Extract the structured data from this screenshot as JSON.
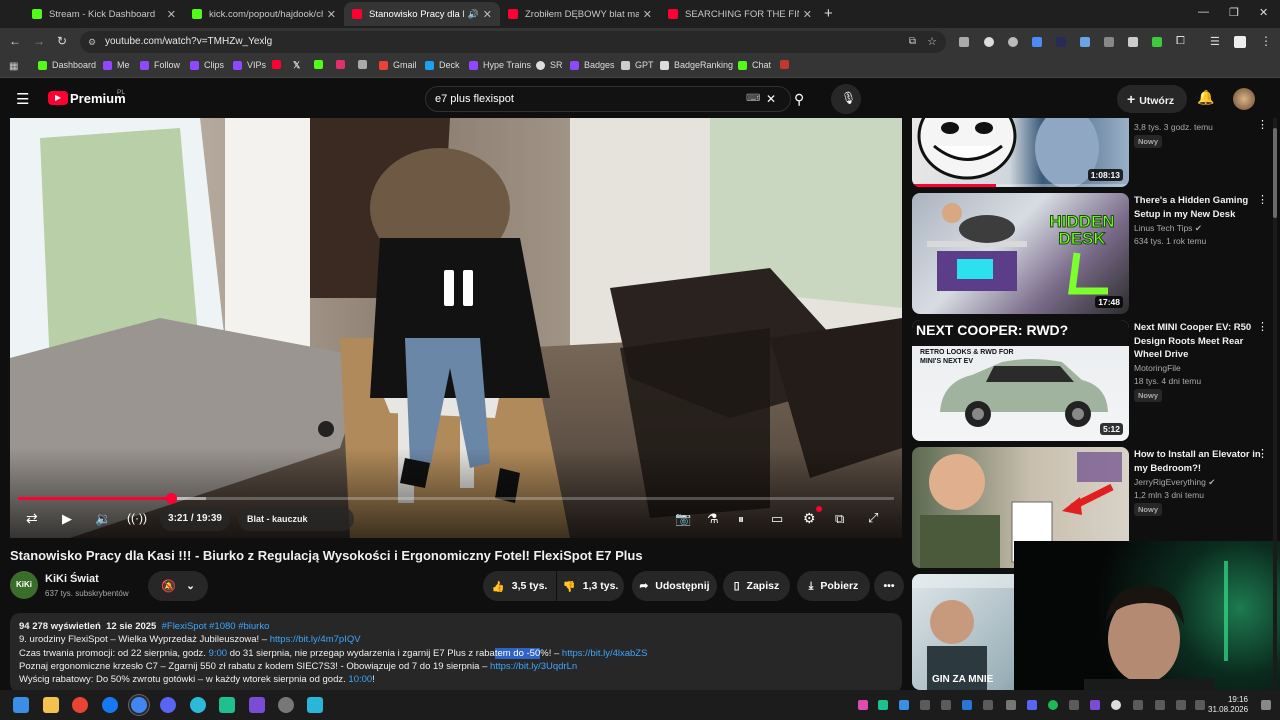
{
  "browser": {
    "tabs": [
      {
        "title": "Stream - Kick Dashboard",
        "color": "#53fc18"
      },
      {
        "title": "kick.com/popout/hajdook/chat",
        "color": "#53fc18"
      },
      {
        "title": "Stanowisko Pracy dla Kasi !!!",
        "color": "#ff0033"
      },
      {
        "title": "Zrobiłem DĘBOWY blat marzeń",
        "color": "#ff0033"
      },
      {
        "title": "SEARCHING FOR THE FINAL PA",
        "color": "#ff0033"
      }
    ],
    "url": "youtube.com/watch?v=TMHZw_Yexlg",
    "bookmarks": [
      "Dashboard",
      "Me",
      "Follow",
      "Clips",
      "VIPs",
      "Gmail",
      "Deck",
      "Hype Trains",
      "SR",
      "Badges",
      "GPT",
      "BadgeRanking",
      "Chat"
    ]
  },
  "youtube": {
    "logo": "Premium",
    "logo_region": "PL",
    "search_value": "e7 plus flexispot",
    "create_label": "Utwórz"
  },
  "player": {
    "time": "3:21 / 19:39",
    "chapter": "Blat - kauczuk naturalny",
    "progress": 0.175,
    "buffered": 0.215
  },
  "video": {
    "title": "Stanowisko Pracy dla Kasi !!! - Biurko z Regulacją Wysokości i Ergonomiczny Fotel! FlexiSpot E7 Plus",
    "channel": "KiKi Świat",
    "subscribers": "637 tys. subskrybentów",
    "likes": "3,5 tys.",
    "dislikes": "1,3 tys.",
    "share": "Udostępnij",
    "save": "Zapisz",
    "download": "Pobierz"
  },
  "description": {
    "views": "94 278 wyświetleń",
    "date": "12 sie 2025",
    "hashtags": "#FlexiSpot #1080 #biurko",
    "line1_text": "9. urodziny FlexiSpot – Wielka Wyprzedaż Jubileuszowa! – ",
    "line1_link": "https://bit.ly/4m7pIQV",
    "line2_a": "Czas trwania promocji: od 22 sierpnia, godz. ",
    "line2_time1": "9:00",
    "line2_b": " do 31 sierpnia, nie przegap wydarzenia i zgarnij E7 Plus z raba",
    "line2_sel": "tem do -50",
    "line2_c": "%! – ",
    "line2_link": "https://bit.ly/4lxabZS",
    "line3_text": "Poznaj ergonomiczne krzesło C7 – Zgarnij 550 zł rabatu z kodem SIEC7S3! - Obowiązuje od 7 do 19 sierpnia – ",
    "line3_link": "https://bit.ly/3UqdrLn",
    "line4_text": "Wyścig rabatowy: Do 50% zwrotu gotówki – w każdy wtorek sierpnia od godz. ",
    "line4_time": "10:00",
    "line4_end": "!"
  },
  "recommendations": [
    {
      "title": "",
      "channel": "",
      "meta": "3,8 tys.   3 godz. temu",
      "badge": "Nowy",
      "duration": "1:08:13"
    },
    {
      "title": "There's a Hidden Gaming Setup in my New Desk",
      "channel": "Linus Tech Tips",
      "meta": "634 tys.   1 rok temu",
      "badge": "",
      "duration": "17:48",
      "thumb_text": "HIDDEN DESK"
    },
    {
      "title": "Next MINI Cooper EV: R50 Design Roots Meet Rear Wheel Drive",
      "channel": "MotoringFile",
      "meta": "18 tys.   4 dni temu",
      "badge": "Nowy",
      "duration": "5:12",
      "thumb_text": "NEXT COOPER: RWD?",
      "thumb_sub": "RETRO LOOKS & RWD FOR MINI'S NEXT EV"
    },
    {
      "title": "How to Install an Elevator in my Bedroom?!",
      "channel": "JerryRigEverything",
      "meta": "1,2 mln   3 dni temu",
      "badge": "Nowy",
      "duration": ""
    },
    {
      "title": "",
      "channel": "",
      "meta": "",
      "badge": "",
      "duration": "",
      "thumb_text": "GIN ZA MNIE"
    }
  ],
  "taskbar": {
    "time": "19:16",
    "date": "31.08.2026"
  }
}
